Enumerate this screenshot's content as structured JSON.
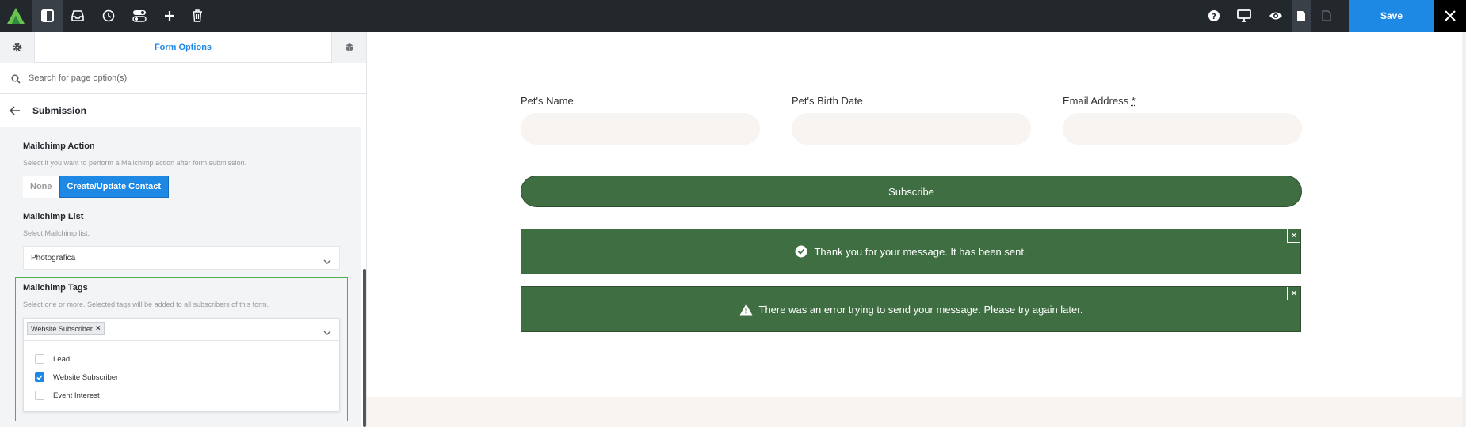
{
  "toolbar": {
    "icons": [
      "logo-icon",
      "sidebar-toggle-icon",
      "inbox-icon",
      "history-icon",
      "toggles-icon",
      "plus-icon",
      "trash-icon"
    ],
    "right_icons": [
      "help-icon",
      "desktop-icon",
      "preview-icon",
      "page-icon",
      "page-outline-icon"
    ],
    "save_label": "Save"
  },
  "sidebar": {
    "tab_label": "Form Options",
    "search_placeholder": "Search for page option(s)",
    "section_title": "Submission",
    "mailchimp_action": {
      "title": "Mailchimp Action",
      "description": "Select if you want to perform a Mailchimp action after form submission.",
      "options": [
        "None",
        "Create/Update Contact"
      ],
      "selected": "Create/Update Contact"
    },
    "mailchimp_list": {
      "title": "Mailchimp List",
      "description": "Select Mailchimp list.",
      "value": "Photografica"
    },
    "mailchimp_tags": {
      "title": "Mailchimp Tags",
      "description": "Select one or more. Selected tags will be added to all subscribers of this form.",
      "chip": "Website Subscriber",
      "chip_remove": "×",
      "items": [
        {
          "label": "Lead",
          "checked": false
        },
        {
          "label": "Website Subscriber",
          "checked": true
        },
        {
          "label": "Event Interest",
          "checked": false
        }
      ]
    }
  },
  "form": {
    "fields": [
      {
        "label": "Pet's Name",
        "required": ""
      },
      {
        "label": "Pet's Birth Date",
        "required": ""
      },
      {
        "label": "Email Address",
        "required": "*"
      }
    ],
    "submit_label": "Subscribe",
    "success_message": "Thank you for your message. It has been sent.",
    "error_message": "There was an error trying to send your message. Please try again later.",
    "close_glyph": "×"
  },
  "colors": {
    "accent": "#1e88e5",
    "form_green": "#3f6e42",
    "topbar": "#23282d",
    "highlight_border": "#4caf50"
  }
}
